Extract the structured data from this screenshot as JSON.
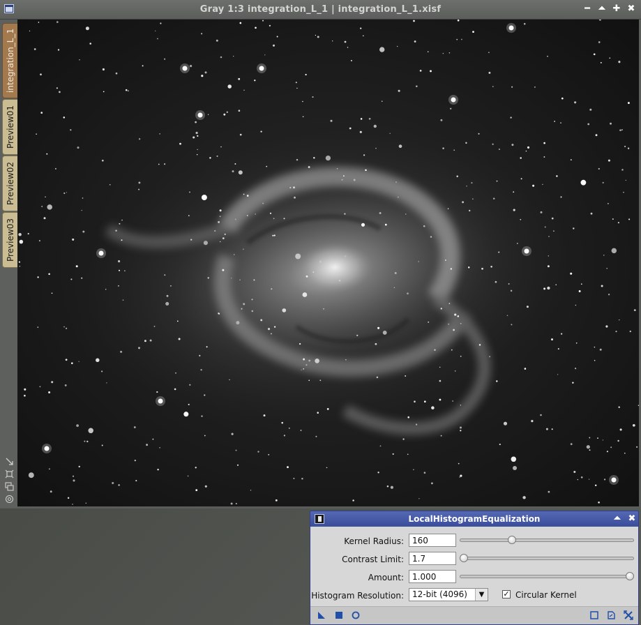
{
  "image_window": {
    "title": "Gray 1:3 integration_L_1 | integration_L_1.xisf",
    "tabs": [
      {
        "label": "integration_L_1"
      },
      {
        "label": "Preview01"
      },
      {
        "label": "Preview02"
      },
      {
        "label": "Preview03"
      }
    ],
    "buttons": {
      "minimize": "━",
      "shade": "⏶",
      "maximize": "✚",
      "close": "✖"
    }
  },
  "dialog": {
    "title": "LocalHistogramEqualization",
    "kernel_radius": {
      "label": "Kernel Radius:",
      "value": "160",
      "level": 0.3
    },
    "contrast_limit": {
      "label": "Contrast Limit:",
      "value": "1.7",
      "level": 0.02
    },
    "amount": {
      "label": "Amount:",
      "value": "1.000",
      "level": 0.98
    },
    "histogram_resolution": {
      "label": "Histogram Resolution:",
      "value": "12-bit (4096)"
    },
    "circular_kernel": {
      "label": "Circular Kernel",
      "checked": true
    },
    "buttons": {
      "shade": "⏶",
      "close": "✖"
    }
  },
  "icons": {
    "process-icon": "process-icon",
    "new-instance-icon": "triangle-icon",
    "apply-global-icon": "square-icon",
    "real-time-preview-icon": "circle-icon",
    "browse-doc-icon": "doc-icon",
    "reset-icon": "reset-icon"
  },
  "colors": {
    "accent": "#3a4d9a",
    "tab": "#cbbd93",
    "active_tab": "#a3794e"
  }
}
